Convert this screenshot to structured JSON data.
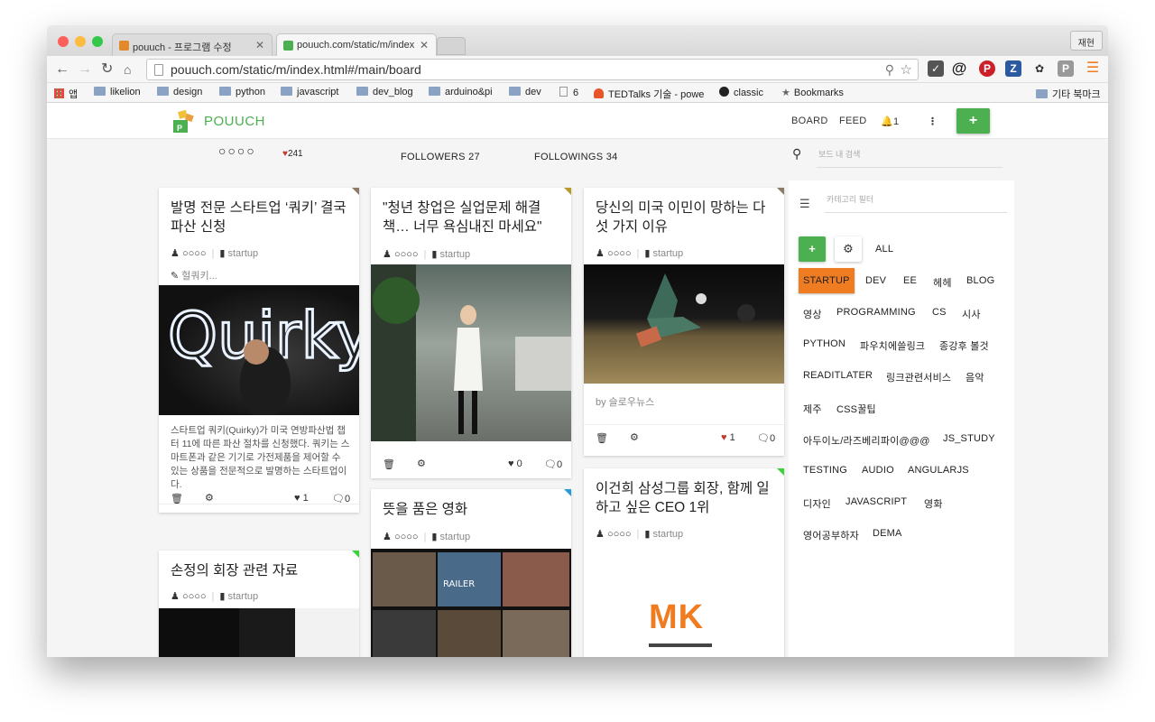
{
  "browser": {
    "tabs": [
      {
        "title": "pouuch - 프로그램 수정",
        "active": false
      },
      {
        "title": "pouuch.com/static/m/index",
        "active": true
      }
    ],
    "profile_label": "재현",
    "url": "pouuch.com/static/m/index.html#/main/board",
    "bookmarks": [
      "앱",
      "likelion",
      "design",
      "python",
      "javascript",
      "dev_blog",
      "arduino&pi",
      "dev",
      "6",
      "TEDTalks 기술 - powe",
      "classic",
      "Bookmarks"
    ],
    "other_bookmarks": "기타 북마크"
  },
  "app": {
    "brand": "POUUCH",
    "nav": {
      "board": "BOARD",
      "feed": "FEED",
      "notifications": "1",
      "add": "+"
    },
    "profile": {
      "name_dots": "○○○○",
      "likes": "241",
      "followers": "FOLLOWERS 27",
      "followings": "FOLLOWINGS 34"
    },
    "search_placeholder": "보드 내 검색",
    "category_filter_placeholder": "카테고리 필터",
    "category_all": "ALL",
    "categories": [
      {
        "label": "STARTUP",
        "selected": true
      },
      {
        "label": "DEV"
      },
      {
        "label": "EE"
      },
      {
        "label": "헤헤"
      },
      {
        "label": "BLOG"
      },
      {
        "label": "영상"
      },
      {
        "label": "PROGRAMMING"
      },
      {
        "label": "CS"
      },
      {
        "label": "시사"
      },
      {
        "label": "PYTHON"
      },
      {
        "label": "파우치에쓸링크"
      },
      {
        "label": "종강후 볼것"
      },
      {
        "label": "READITLATER"
      },
      {
        "label": "링크관련서비스"
      },
      {
        "label": "음악"
      },
      {
        "label": "제주"
      },
      {
        "label": "CSS꿀팁"
      },
      {
        "label": "아두이노/라즈베리파이@@@"
      },
      {
        "label": "JS_STUDY"
      },
      {
        "label": "TESTING"
      },
      {
        "label": "AUDIO"
      },
      {
        "label": "ANGULARJS"
      },
      {
        "label": "디자인"
      },
      {
        "label": "JAVASCRIPT"
      },
      {
        "label": "영화"
      },
      {
        "label": "영어공부하자"
      },
      {
        "label": "DEMA"
      }
    ],
    "cards": [
      {
        "title": "발명 전문 스타트업 ‘쿼키’ 결국 파산 신청",
        "user": "○○○○",
        "category": "startup",
        "note": "헐쿼키...",
        "image_text": "Quirky",
        "body": "스타트업 쿼키(Quirky)가 미국 연방파산법 챕터 11에 따른 파산 절차를 신청했다. 쿼키는 스마트폰과 같은 기기로 가전제품을 제어할 수 있는 상품을 전문적으로 발명하는 스타트업이다.",
        "likes": "1",
        "comments": "0",
        "corner_color": "#8a7a66"
      },
      {
        "title": "\"청년 창업은 실업문제 해결책… 너무 욕심내진 마세요\"",
        "user": "○○○○",
        "category": "startup",
        "likes": "0",
        "comments": "0",
        "corner_color": "#b89a2a"
      },
      {
        "title": "당신의 미국 이민이 망하는 다섯 가지 이유",
        "user": "○○○○",
        "category": "startup",
        "source": "by 슬로우뉴스",
        "likes": "1",
        "comments": "0",
        "corner_color": "#8a7a66"
      },
      {
        "title": "손정의 회장 관련 자료",
        "user": "○○○○",
        "category": "startup",
        "corner_color": "#3bd23b"
      },
      {
        "title": "뜻을 품은 영화",
        "user": "○○○○",
        "category": "startup",
        "image_text": "RAILER",
        "corner_color": "#2a9ad8"
      },
      {
        "title": "이건희 삼성그룹 회장, 함께 일하고 싶은 CEO 1위",
        "user": "○○○○",
        "category": "startup",
        "image_text": "MK",
        "corner_color": "#3bd23b"
      }
    ]
  },
  "colors": {
    "green": "#4caf50",
    "orange": "#f07c22",
    "heart": "#c0392b"
  }
}
